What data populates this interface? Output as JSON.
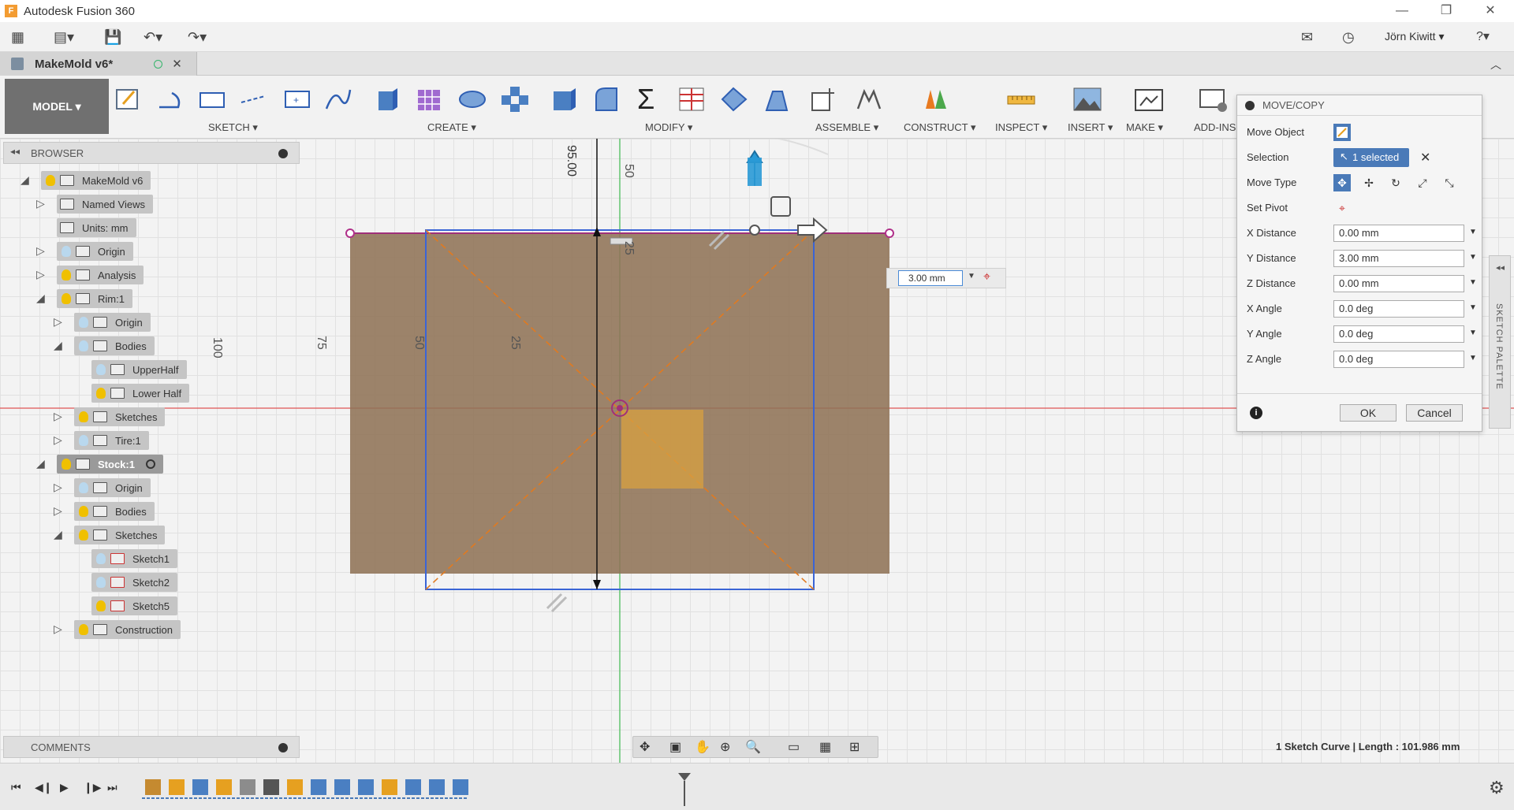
{
  "app": {
    "window_title": "Autodesk Fusion 360",
    "logo_letter": "F"
  },
  "qat": {
    "user_name": "Jörn Kiwitt ▾",
    "help_label": "?▾"
  },
  "document": {
    "tab_name": "MakeMold v6*",
    "close_glyph": "✕"
  },
  "ribbon": {
    "workspace": "MODEL ▾",
    "groups": [
      "SKETCH ▾",
      "CREATE ▾",
      "MODIFY ▾",
      "ASSEMBLE ▾",
      "CONSTRUCT ▾",
      "INSPECT ▾",
      "INSERT ▾",
      "MAKE ▾",
      "ADD-INS ▾"
    ]
  },
  "browser": {
    "header": "BROWSER",
    "items": [
      {
        "label": "MakeMold v6"
      },
      {
        "label": "Named Views"
      },
      {
        "label": "Units: mm"
      },
      {
        "label": "Origin"
      },
      {
        "label": "Analysis"
      },
      {
        "label": "Rim:1"
      },
      {
        "label": "Origin"
      },
      {
        "label": "Bodies"
      },
      {
        "label": "UpperHalf"
      },
      {
        "label": "Lower Half"
      },
      {
        "label": "Sketches"
      },
      {
        "label": "Tire:1"
      },
      {
        "label": "Stock:1"
      },
      {
        "label": "Origin"
      },
      {
        "label": "Bodies"
      },
      {
        "label": "Sketches"
      },
      {
        "label": "Sketch1"
      },
      {
        "label": "Sketch2"
      },
      {
        "label": "Sketch5"
      },
      {
        "label": "Construction"
      }
    ]
  },
  "comments": {
    "header": "COMMENTS"
  },
  "viewport": {
    "dim_label": "95.00",
    "ruler_labels": [
      "50",
      "25",
      "100",
      "75",
      "50",
      "25"
    ],
    "distance_input": "3.00 mm"
  },
  "dialog": {
    "title": "MOVE/COPY",
    "move_object_label": "Move Object",
    "selection_label": "Selection",
    "selection_value": "1 selected",
    "move_type_label": "Move Type",
    "set_pivot_label": "Set Pivot",
    "fields": [
      {
        "label": "X Distance",
        "value": "0.00 mm"
      },
      {
        "label": "Y Distance",
        "value": "3.00 mm"
      },
      {
        "label": "Z Distance",
        "value": "0.00 mm"
      },
      {
        "label": "X Angle",
        "value": "0.0 deg"
      },
      {
        "label": "Y Angle",
        "value": "0.0 deg"
      },
      {
        "label": "Z Angle",
        "value": "0.0 deg"
      }
    ],
    "ok_label": "OK",
    "cancel_label": "Cancel"
  },
  "sketch_palette": {
    "label": "SKETCH PALETTE"
  },
  "status": {
    "text": "1 Sketch Curve | Length : 101.986 mm"
  },
  "colors": {
    "accent_blue": "#4a7ab8",
    "body_fill": "#8f7356",
    "selection_outline": "#3a64d6",
    "axis_red": "#e05555",
    "axis_green": "#3fb950"
  }
}
